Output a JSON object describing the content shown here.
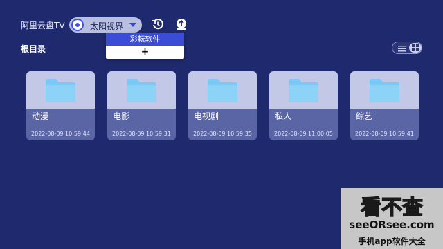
{
  "app": {
    "title": "阿里云盘TV",
    "account_name": "太阳视界"
  },
  "icons": {
    "account": "account-avatar-icon",
    "caret": "chevron-down-icon",
    "history": "history-icon",
    "upload": "upload-icon",
    "list_view": "list-view-icon",
    "grid_view": "grid-view-icon",
    "folder": "folder-icon"
  },
  "dropdown": {
    "items": [
      {
        "label": "彩耘软件",
        "selected": true
      }
    ],
    "add_label": "+"
  },
  "breadcrumb": "根目录",
  "folders": [
    {
      "name": "动漫",
      "date": "2022-08-09 10:59:44"
    },
    {
      "name": "电影",
      "date": "2022-08-09 10:59:31"
    },
    {
      "name": "电视剧",
      "date": "2022-08-09 10:59:35"
    },
    {
      "name": "私人",
      "date": "2022-08-09 11:00:05"
    },
    {
      "name": "综艺",
      "date": "2022-08-09 10:59:41"
    }
  ],
  "watermark": {
    "logo_text": "看不查",
    "url": "seeORsee.com",
    "caption": "手机app软件大全"
  },
  "colors": {
    "background": "#1f2a6e",
    "accent": "#3b4cd6",
    "folder": "#7cc8f4",
    "card": "#5a65a6",
    "card_top": "#c3c8e6"
  }
}
